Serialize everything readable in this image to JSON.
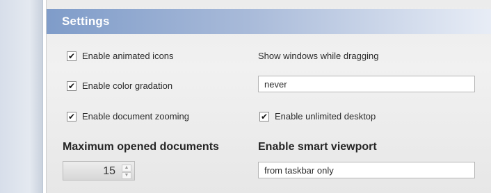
{
  "panel": {
    "title": "Settings"
  },
  "left_column": {
    "checkboxes": [
      {
        "label": "Enable animated icons",
        "checked": true
      },
      {
        "label": "Enable color gradation",
        "checked": true
      },
      {
        "label": "Enable document zooming",
        "checked": true
      }
    ],
    "max_docs": {
      "label": "Maximum opened documents",
      "value": "15"
    }
  },
  "right_column": {
    "show_windows_label": "Show windows while dragging",
    "show_windows_value": "never",
    "unlimited_desktop": {
      "label": "Enable unlimited desktop",
      "checked": true
    },
    "smart_viewport": {
      "label": "Enable smart viewport",
      "value": "from taskbar only"
    }
  },
  "icons": {
    "check": "check-icon",
    "spin_up": "chevron-up-icon",
    "spin_down": "chevron-down-icon"
  },
  "colors": {
    "header_start": "#7f9cc9",
    "header_end": "#e8edf6",
    "panel_bg": "#ececec"
  }
}
